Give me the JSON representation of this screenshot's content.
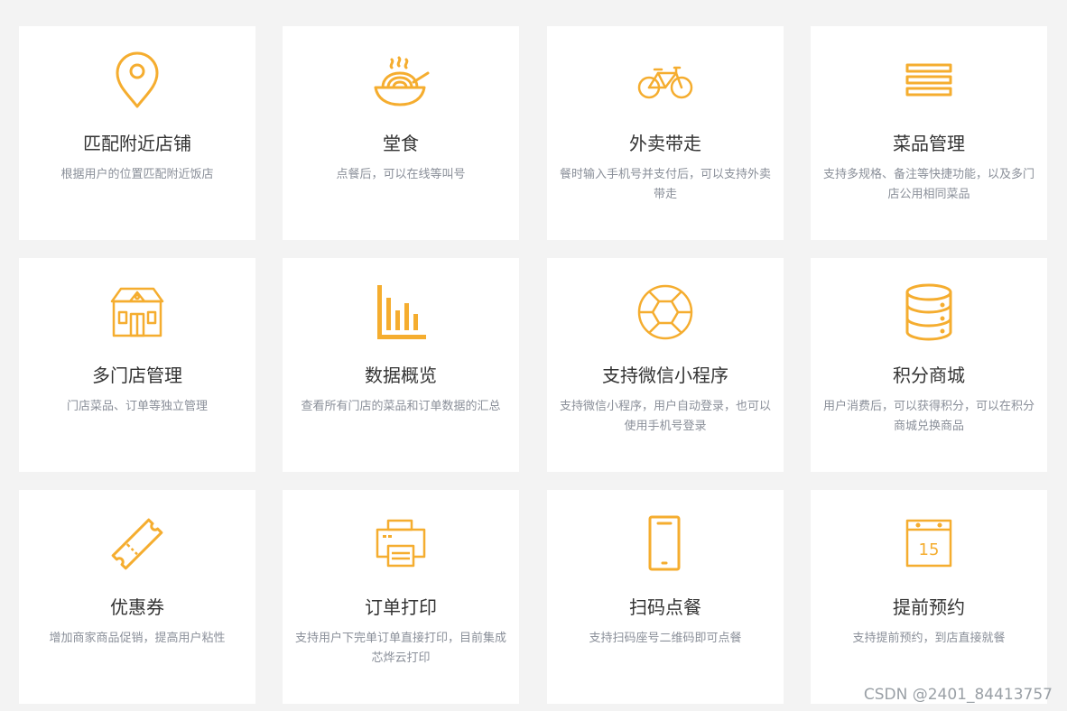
{
  "accent_color": "#f5ad2f",
  "features": [
    {
      "icon": "location-pin-icon",
      "title": "匹配附近店铺",
      "desc": "根据用户的位置匹配附近饭店"
    },
    {
      "icon": "noodle-bowl-icon",
      "title": "堂食",
      "desc": "点餐后，可以在线等叫号"
    },
    {
      "icon": "bicycle-icon",
      "title": "外卖带走",
      "desc": "餐时输入手机号并支付后，可以支持外卖带走"
    },
    {
      "icon": "menu-lines-icon",
      "title": "菜品管理",
      "desc": "支持多规格、备注等快捷功能，以及多门店公用相同菜品"
    },
    {
      "icon": "store-house-icon",
      "title": "多门店管理",
      "desc": "门店菜品、订单等独立管理"
    },
    {
      "icon": "bar-chart-icon",
      "title": "数据概览",
      "desc": "查看所有门店的菜品和订单数据的汇总"
    },
    {
      "icon": "aperture-icon",
      "title": "支持微信小程序",
      "desc": "支持微信小程序，用户自动登录，也可以使用手机号登录"
    },
    {
      "icon": "database-stack-icon",
      "title": "积分商城",
      "desc": "用户消费后，可以获得积分，可以在积分商城兑换商品"
    },
    {
      "icon": "coupon-ticket-icon",
      "title": "优惠券",
      "desc": "增加商家商品促销，提高用户粘性"
    },
    {
      "icon": "printer-icon",
      "title": "订单打印",
      "desc": "支持用户下完单订单直接打印，目前集成芯烨云打印"
    },
    {
      "icon": "mobile-phone-icon",
      "title": "扫码点餐",
      "desc": "支持扫码座号二维码即可点餐"
    },
    {
      "icon": "calendar-icon",
      "title": "提前预约",
      "desc": "支持提前预约，到店直接就餐",
      "calendar_day": "15"
    }
  ],
  "watermark": "CSDN @2401_84413757"
}
